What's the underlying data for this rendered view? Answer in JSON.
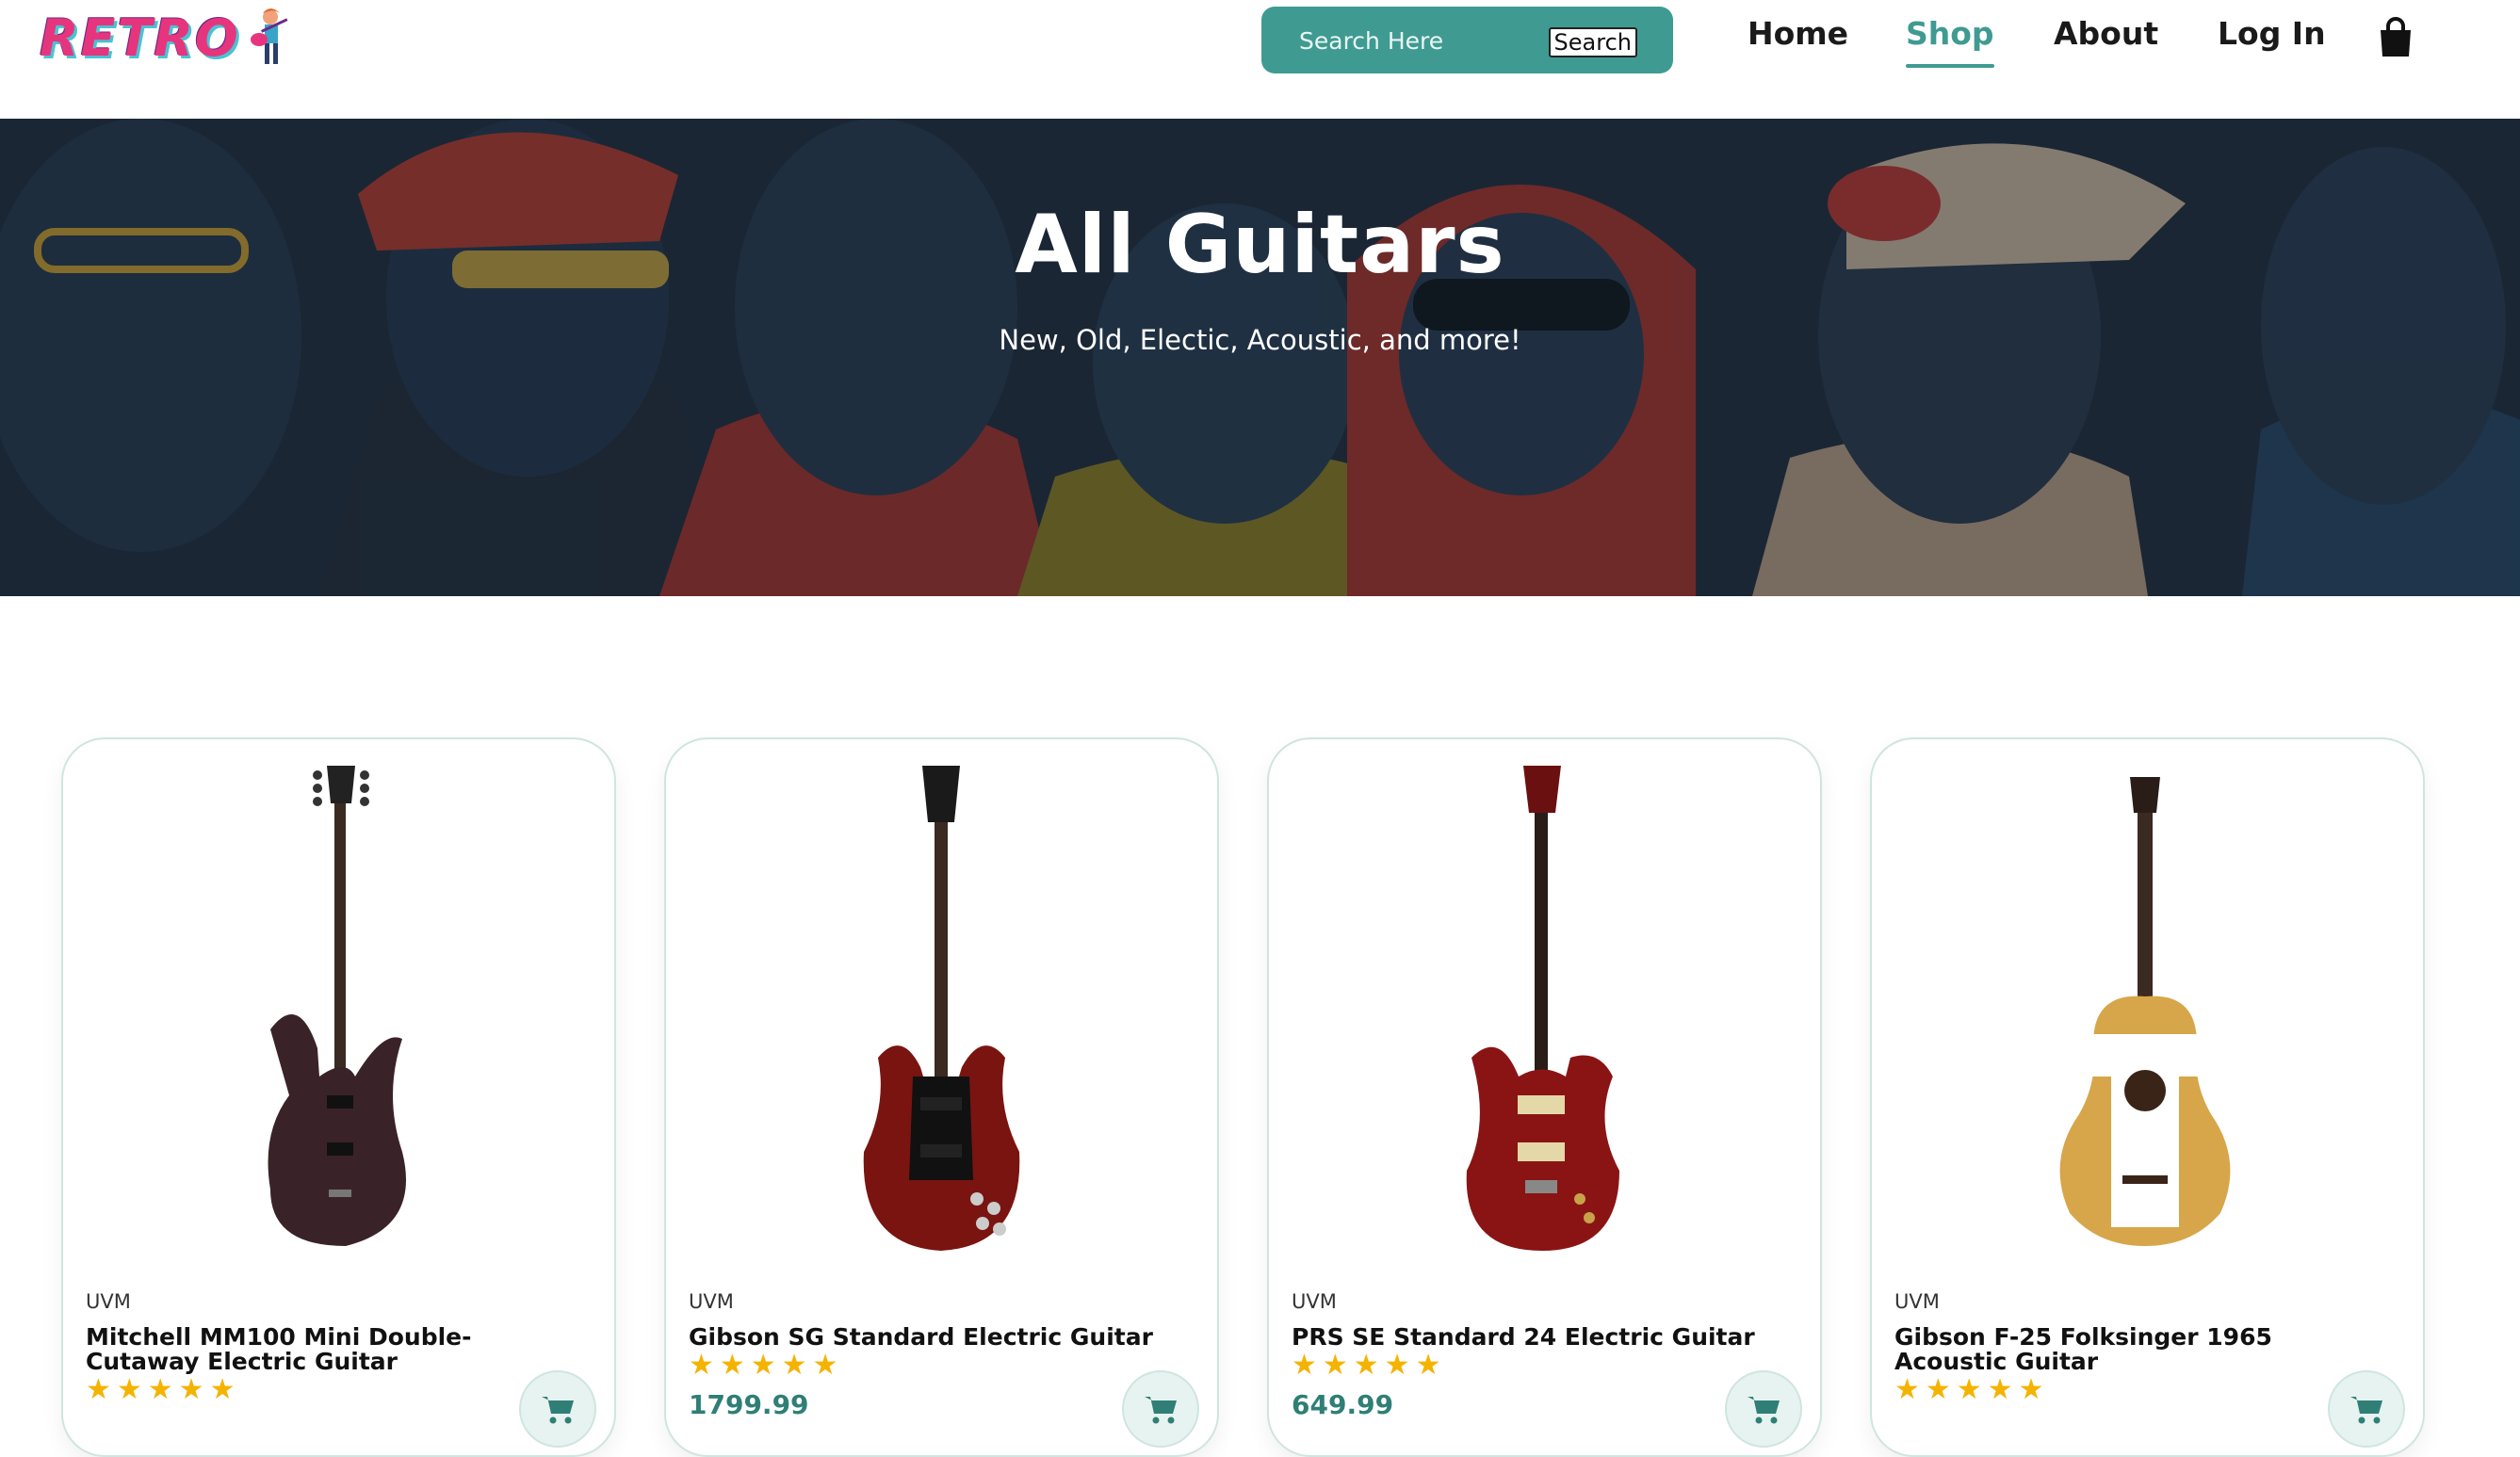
{
  "header": {
    "logo_text": "RETRO",
    "search": {
      "placeholder": "Search Here",
      "button_label": "Search"
    },
    "nav": [
      {
        "label": "Home",
        "active": false
      },
      {
        "label": "Shop",
        "active": true
      },
      {
        "label": "About",
        "active": false
      },
      {
        "label": "Log In",
        "active": false
      }
    ],
    "bag_icon": "shopping-bag-icon"
  },
  "hero": {
    "title": "All Guitars",
    "subtitle": "New, Old, Electic, Acoustic, and more!"
  },
  "colors": {
    "accent": "#3f9b92",
    "star": "#f5b301",
    "price": "#2f7f76",
    "hero_bg": "#1f2a3a"
  },
  "products": [
    {
      "brand": "UVM",
      "name": "Mitchell MM100 Mini Double-Cutaway Electric Guitar",
      "rating": 5,
      "rating_text": "★★★★★",
      "price": "",
      "body": "#3a2328",
      "type": "electric-strat"
    },
    {
      "brand": "UVM",
      "name": "Gibson SG Standard Electric Guitar",
      "rating": 5,
      "rating_text": "★★★★★",
      "price": "1799.99",
      "body": "#7a1410",
      "type": "electric-sg"
    },
    {
      "brand": "UVM",
      "name": "PRS SE Standard 24 Electric Guitar",
      "rating": 5,
      "rating_text": "★★★★★",
      "price": "649.99",
      "body": "#8a1414",
      "type": "electric-prs"
    },
    {
      "brand": "UVM",
      "name": "Gibson F-25 Folksinger 1965 Acoustic Guitar",
      "rating": 5,
      "rating_text": "★★★★★",
      "price": "",
      "body": "#d7a64a",
      "type": "acoustic"
    }
  ]
}
